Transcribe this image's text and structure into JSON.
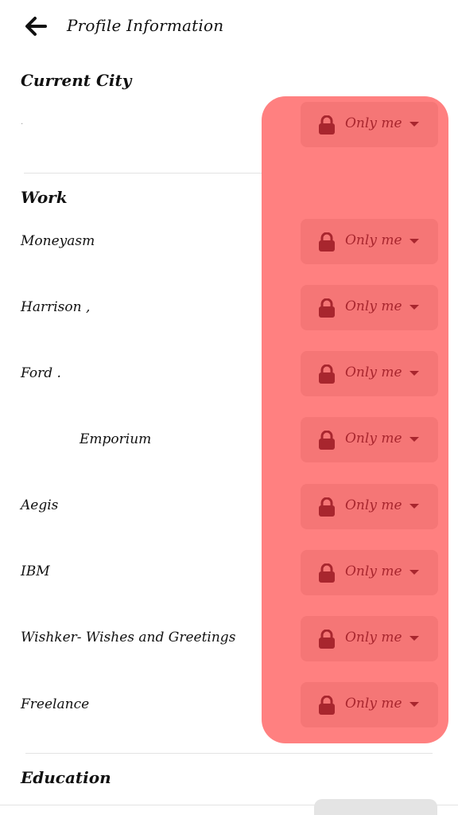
{
  "header": {
    "title": "Profile Information",
    "back_icon": "arrow-left-icon"
  },
  "sections": {
    "current_city": {
      "title": "Current City",
      "value": ".",
      "privacy": "Only me"
    },
    "work": {
      "title": "Work",
      "items": [
        {
          "label": "Moneyasm",
          "privacy": "Only me"
        },
        {
          "label": "Harrison ,",
          "privacy": "Only me"
        },
        {
          "label": "Ford .",
          "privacy": "Only me"
        },
        {
          "label": "Emporium",
          "privacy": "Only me"
        },
        {
          "label": "Aegis",
          "privacy": "Only me"
        },
        {
          "label": "IBM",
          "privacy": "Only me"
        },
        {
          "label": "Wishker- Wishes and Greetings",
          "privacy": "Only me"
        },
        {
          "label": "Freelance",
          "privacy": "Only me"
        }
      ]
    },
    "education": {
      "title": "Education"
    }
  },
  "colors": {
    "highlight": "#ff8080",
    "privacy_text": "#a8262e"
  }
}
